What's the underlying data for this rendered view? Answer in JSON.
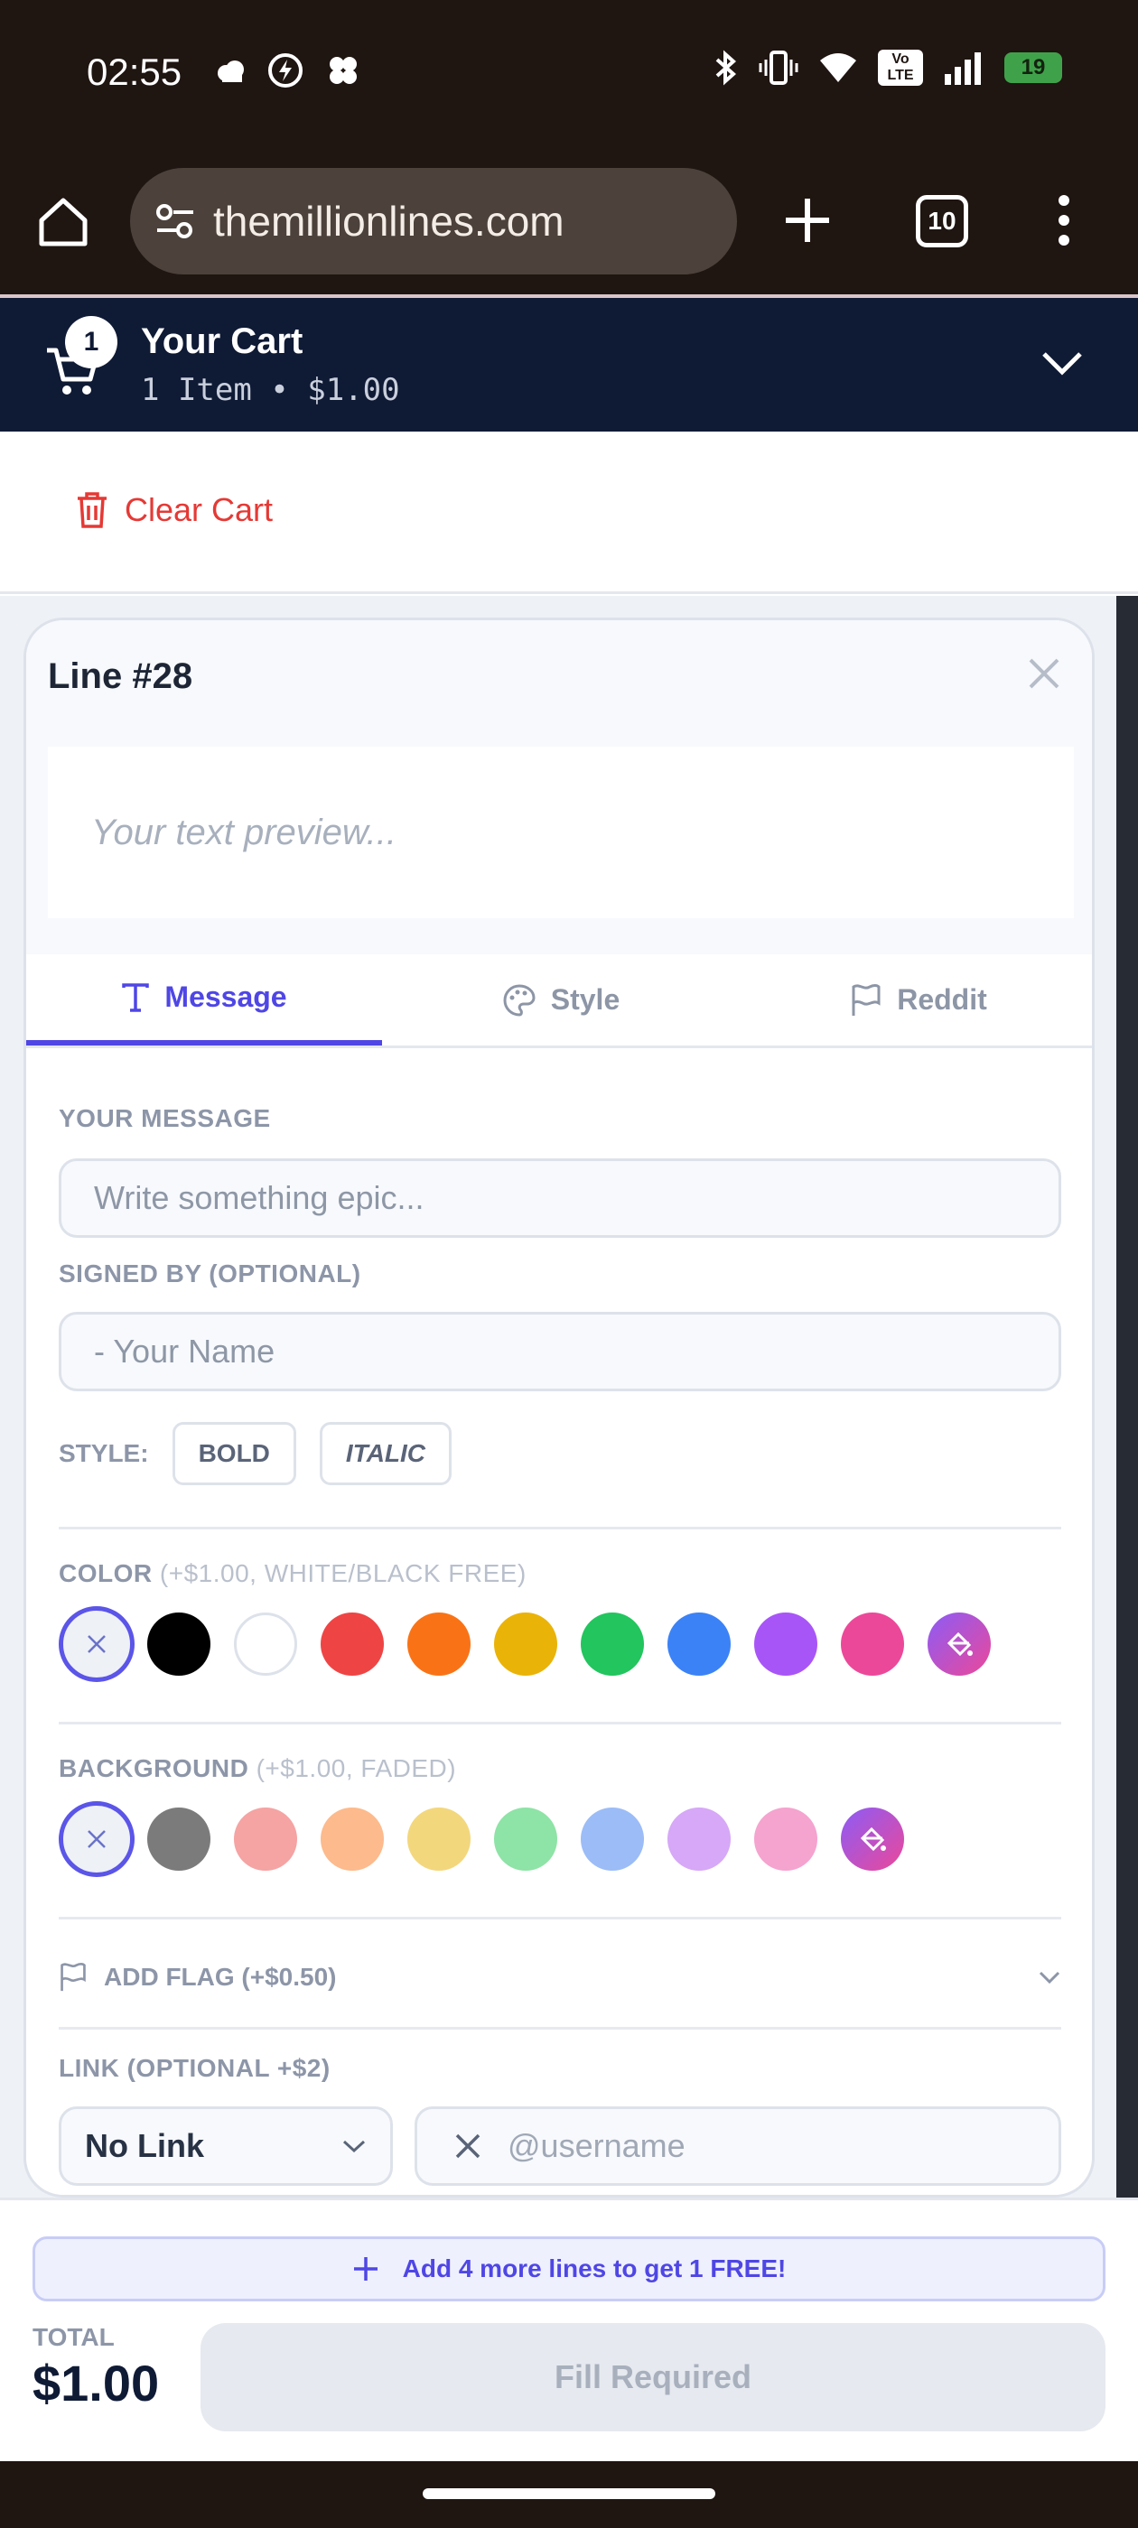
{
  "status_bar": {
    "time": "02:55",
    "battery": "19"
  },
  "browser": {
    "url": "themillionlines.com",
    "tab_count": "10"
  },
  "cart": {
    "badge": "1",
    "title": "Your Cart",
    "summary": "1 Item • $1.00",
    "clear_label": "Clear Cart"
  },
  "line_card": {
    "title": "Line #28",
    "preview_placeholder": "Your text preview...",
    "tabs": [
      {
        "label": "Message",
        "active": true
      },
      {
        "label": "Style",
        "active": false
      },
      {
        "label": "Reddit",
        "active": false
      }
    ],
    "message": {
      "label": "YOUR MESSAGE",
      "placeholder": "Write something epic..."
    },
    "signed_by": {
      "label": "SIGNED BY (OPTIONAL)",
      "placeholder": "- Your Name"
    },
    "style": {
      "label": "STYLE:",
      "bold": "BOLD",
      "italic": "ITALIC"
    },
    "color": {
      "label": "COLOR",
      "note": "(+$1.00, WHITE/BLACK FREE)",
      "swatches": [
        "#000000",
        "#ffffff",
        "#ef4444",
        "#f97316",
        "#eab308",
        "#22c55e",
        "#3b82f6",
        "#a855f7",
        "#ec4899"
      ]
    },
    "background": {
      "label": "BACKGROUND",
      "note": "(+$1.00, FADED)",
      "swatches": [
        "#7b7b7b",
        "#f5a3a3",
        "#fdba8c",
        "#f3d77d",
        "#8ee3a6",
        "#9bbcf7",
        "#d6a8f7",
        "#f5a3cf"
      ]
    },
    "flag": {
      "label": "ADD FLAG (+$0.50)"
    },
    "link": {
      "label": "LINK (OPTIONAL +$2)",
      "selected": "No Link",
      "username_placeholder": "@username"
    }
  },
  "footer": {
    "promo": "Add 4 more lines to get 1 FREE!",
    "total_label": "TOTAL",
    "total_value": "$1.00",
    "submit_label": "Fill Required"
  },
  "colors": {
    "accent": "#4f46e5",
    "header_bg": "#0f1a35",
    "danger": "#e53935"
  }
}
